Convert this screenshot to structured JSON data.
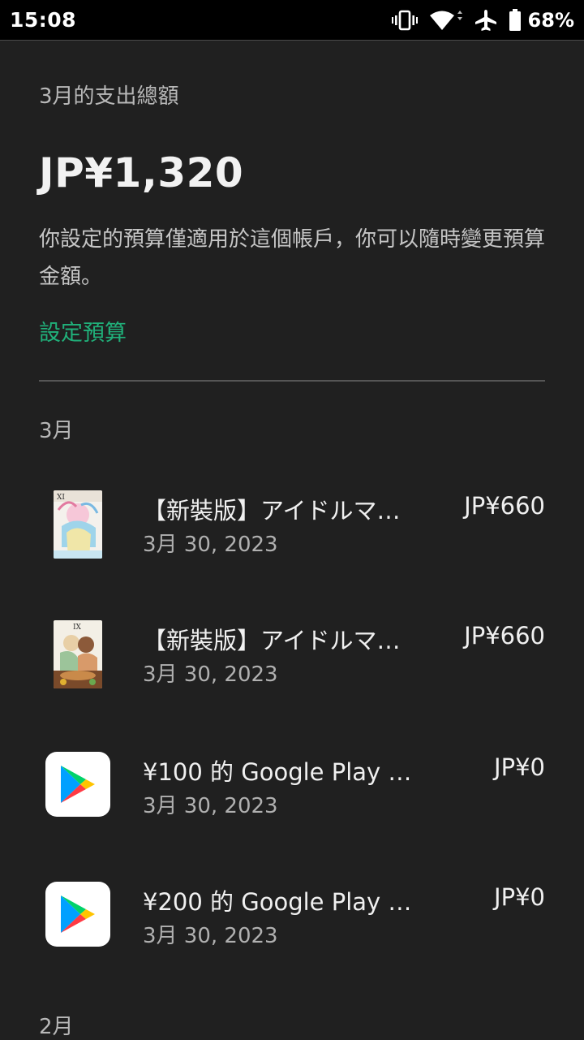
{
  "status_bar": {
    "time": "15:08",
    "battery": "68%",
    "icons": [
      "vibrate-icon",
      "wifi-icon",
      "airplane-icon",
      "battery-icon"
    ]
  },
  "summary": {
    "heading": "3月的支出總額",
    "total": "JP¥1,320",
    "description": "你設定的預算僅適用於這個帳戶，你可以隨時變更預算金額。",
    "budget_link": "設定預算"
  },
  "sections": [
    {
      "month": "3月",
      "items": [
        {
          "title": "【新裝版】アイドルマ…",
          "date": "3月 30, 2023",
          "price": "JP¥660",
          "icon": "book-cover-icon"
        },
        {
          "title": "【新裝版】アイドルマ…",
          "date": "3月 30, 2023",
          "price": "JP¥660",
          "icon": "book-cover-icon"
        },
        {
          "title": "¥100 的 Google Play 抵…",
          "date": "3月 30, 2023",
          "price": "JP¥0",
          "icon": "google-play-icon"
        },
        {
          "title": "¥200 的 Google Play 抵…",
          "date": "3月 30, 2023",
          "price": "JP¥0",
          "icon": "google-play-icon"
        }
      ]
    },
    {
      "month": "2月"
    }
  ],
  "colors": {
    "background": "#202020",
    "accent": "#20b07a",
    "status_bar": "#000000"
  }
}
